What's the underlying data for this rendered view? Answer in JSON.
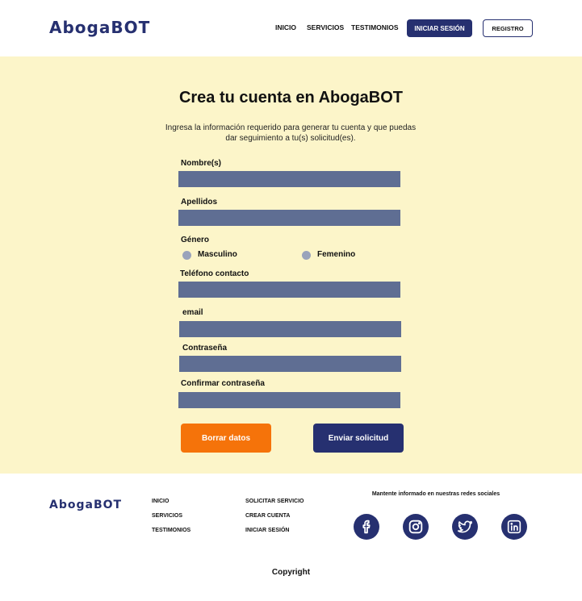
{
  "header": {
    "brand": "AbogaBOT",
    "nav": [
      "INICIO",
      "SERVICIOS",
      "TESTIMONIOS"
    ],
    "login_label": "INICIAR SESIÓN",
    "register_label": "REGISTRO"
  },
  "form": {
    "title": "Crea tu cuenta en AbogaBOT",
    "subtitle_line1": "Ingresa la información requerido para generar tu cuenta y que puedas",
    "subtitle_line2": "dar seguimiento a tu(s) solicitud(es).",
    "fields": {
      "nombre": "Nombre(s)",
      "apellidos": "Apellidos",
      "genero": "Género",
      "telefono": "Teléfono contacto",
      "email": "email",
      "contrasena": "Contraseña",
      "confirmar": "Confirmar contraseña"
    },
    "gender_options": [
      "Masculino",
      "Femenino"
    ],
    "clear_label": "Borrar datos",
    "submit_label": "Enviar solicitud"
  },
  "footer": {
    "brand": "AbogaBOT",
    "col1": [
      "INICIO",
      "SERVICIOS",
      "TESTIMONIOS"
    ],
    "col2": [
      "SOLICITAR SERVICIO",
      "CREAR CUENTA",
      "INICIAR SESIÓN"
    ],
    "social_title": "Mantente informado en nuestras redes sociales",
    "social_icons": [
      "facebook-icon",
      "instagram-icon",
      "twitter-icon",
      "linkedin-icon"
    ],
    "copyright": "Copyright"
  },
  "colors": {
    "brand_navy": "#263070",
    "accent_orange": "#f5730a",
    "form_bg": "#fcf5c9",
    "input_fill": "#5f6e93"
  }
}
